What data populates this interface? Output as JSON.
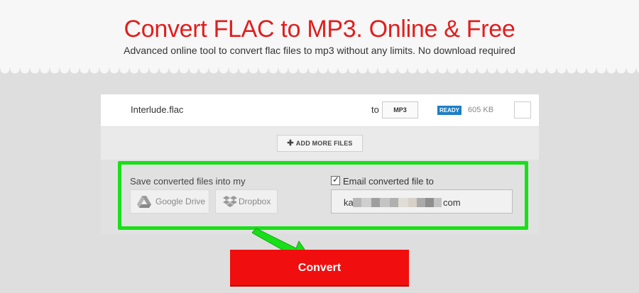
{
  "header": {
    "title": "Convert FLAC to MP3. Online & Free",
    "subtitle": "Advanced online tool to convert flac files to mp3 without any limits. No download required"
  },
  "file": {
    "name": "Interlude.flac",
    "to_label": "to",
    "format": "MP3",
    "status": "READY",
    "size": "605 KB"
  },
  "add_more_label": "ADD MORE FILES",
  "save": {
    "label": "Save converted files into my",
    "google_drive": "Google Drive",
    "dropbox": "Dropbox"
  },
  "email": {
    "checked": true,
    "label": "Email converted file to",
    "value_start": "ka",
    "value_end": "com"
  },
  "convert_label": "Convert",
  "colors": {
    "title": "#e21d1d",
    "convert": "#f00e0e",
    "highlight": "#18e018",
    "ready_badge": "#1b7fc4"
  }
}
